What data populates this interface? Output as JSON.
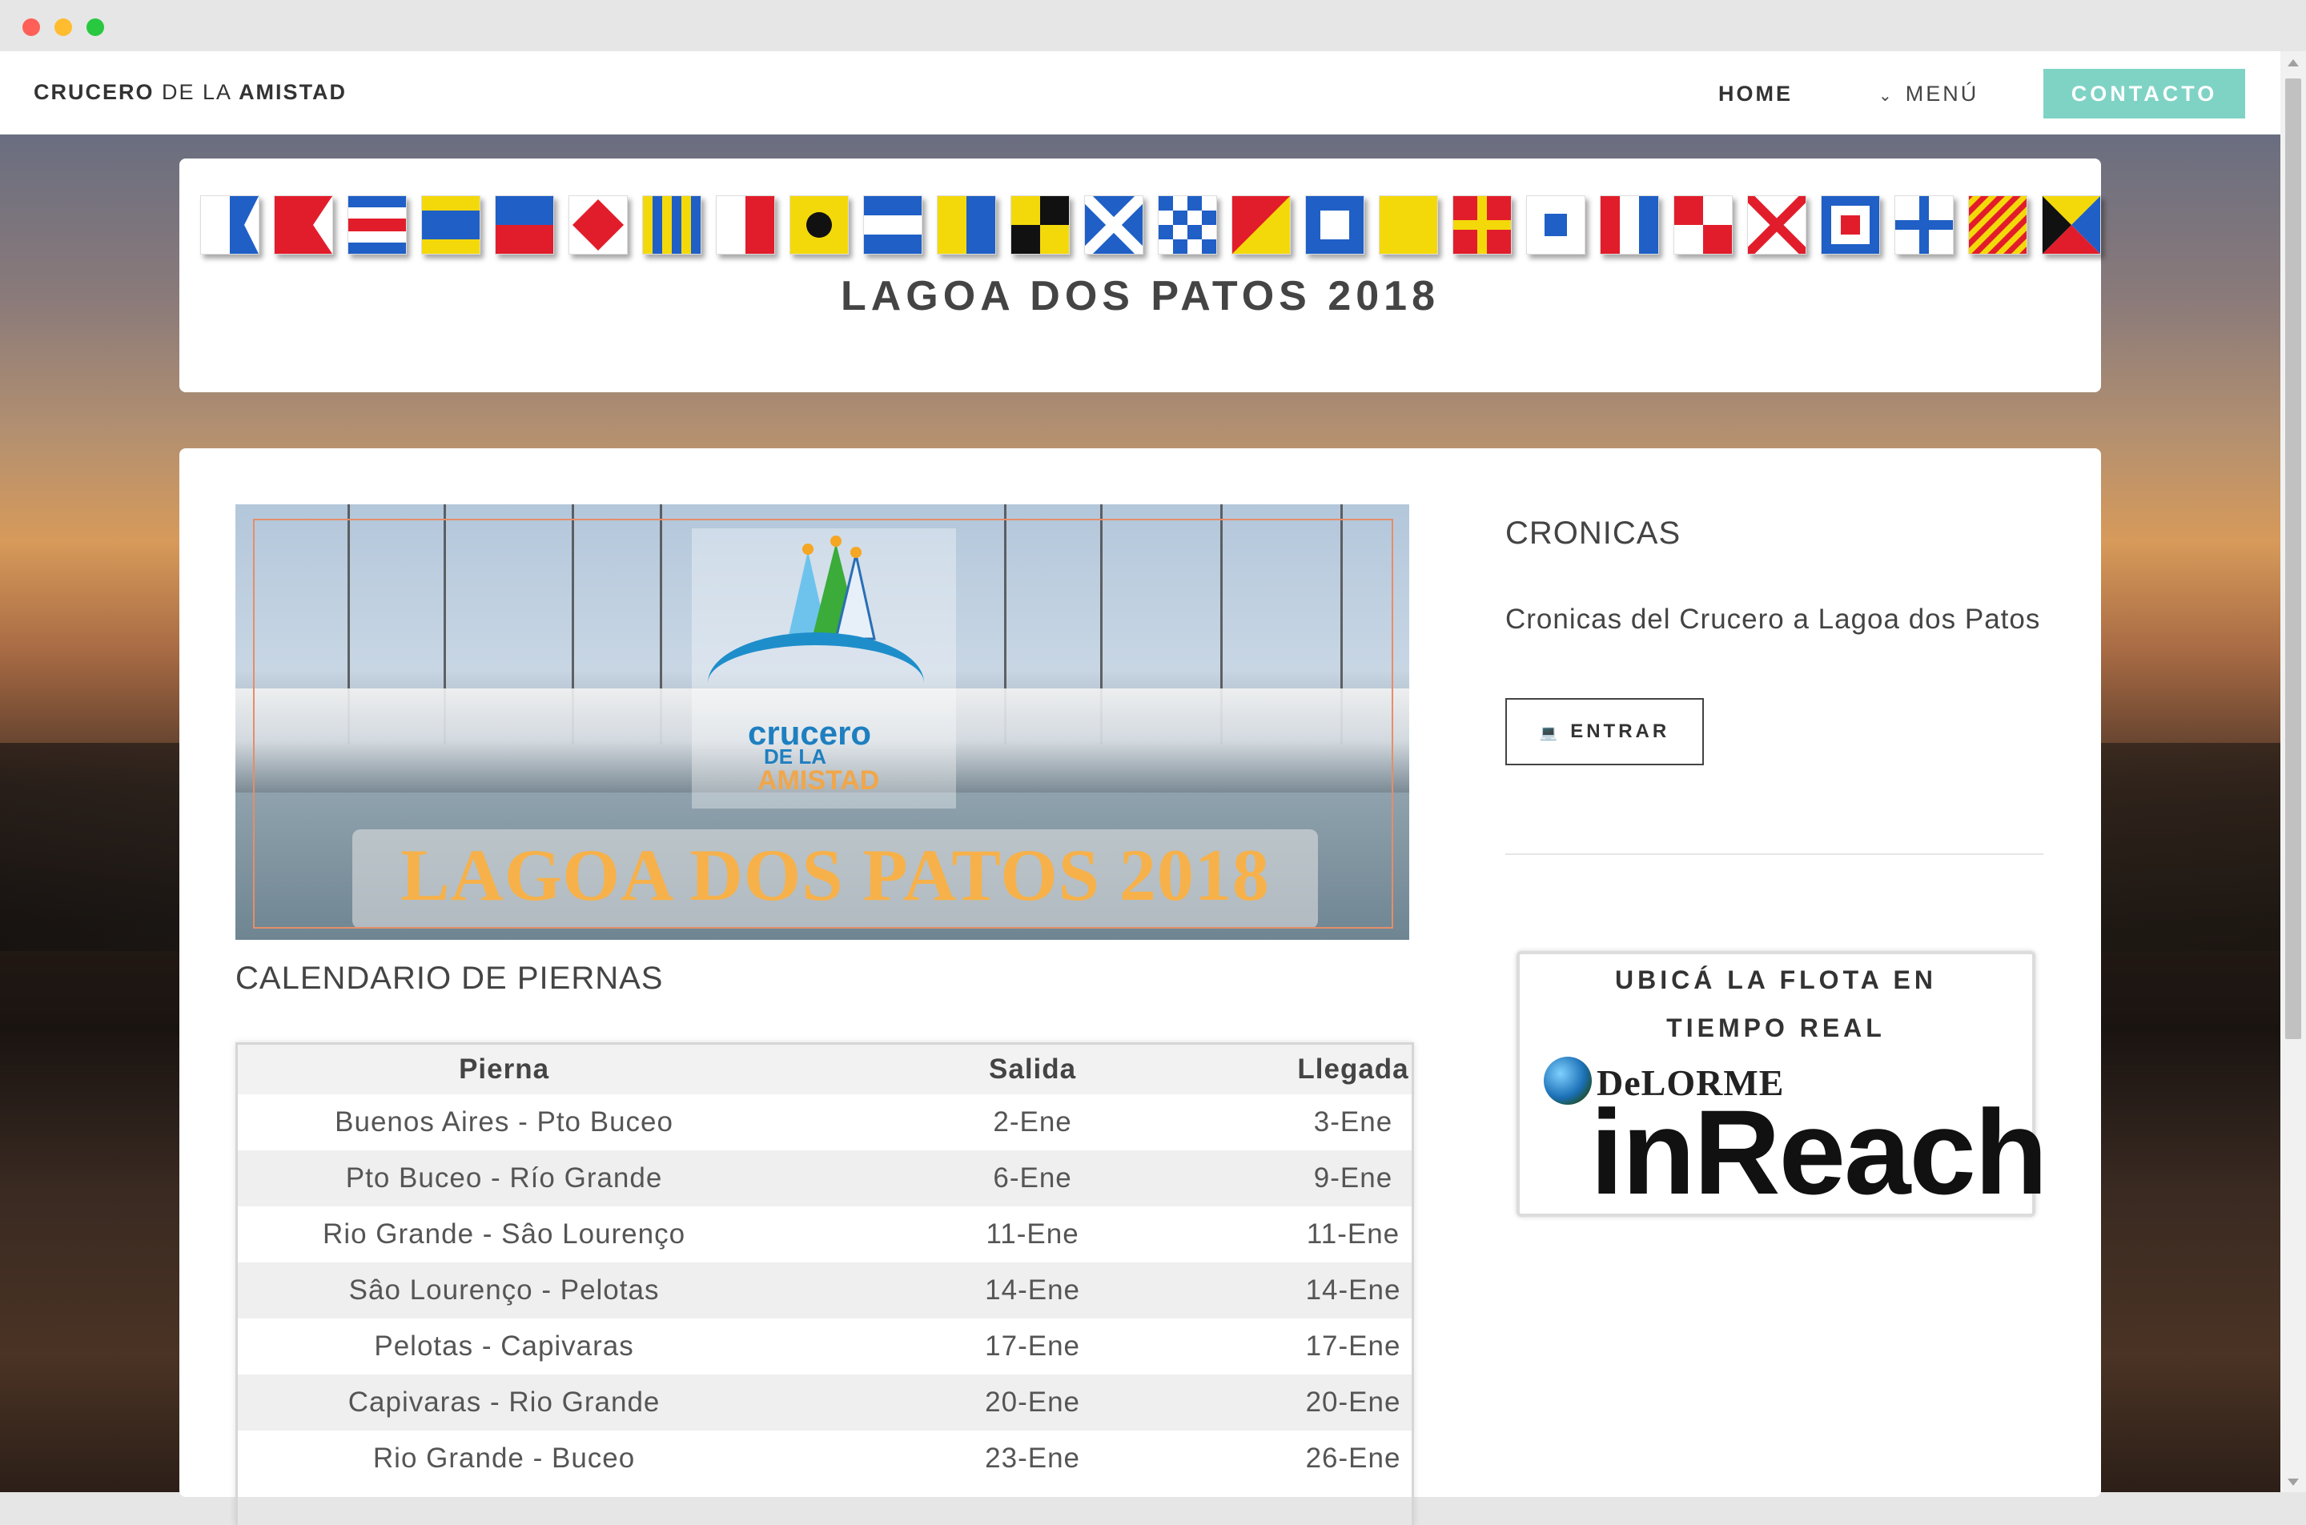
{
  "nav": {
    "brand": {
      "part1": "CRUCERO",
      "part2": " DE LA ",
      "part3": "AMISTAD"
    },
    "home": "HOME",
    "menu": "MENÚ",
    "contact": "CONTACTO"
  },
  "header": {
    "title": "LAGOA DOS PATOS 2018",
    "flags": [
      "A",
      "B",
      "C",
      "D",
      "E",
      "F",
      "G",
      "H",
      "I",
      "J",
      "K",
      "L",
      "M",
      "N",
      "O",
      "P",
      "Q",
      "R",
      "S",
      "T",
      "U",
      "V",
      "W",
      "X",
      "Y",
      "Z"
    ]
  },
  "banner": {
    "logo_line1": "crucero",
    "logo_line2": "DE LA",
    "logo_line3": "AMISTAD",
    "title": "LAGOA DOS PATOS 2018"
  },
  "calendar": {
    "heading": "CALENDARIO DE PIERNAS",
    "columns": [
      "Pierna",
      "Salida",
      "Llegada"
    ],
    "rows": [
      [
        "Buenos Aires - Pto Buceo",
        "2-Ene",
        "3-Ene"
      ],
      [
        "Pto Buceo - Río Grande",
        "6-Ene",
        "9-Ene"
      ],
      [
        "Rio Grande - Sâo Lourenço",
        "11-Ene",
        "11-Ene"
      ],
      [
        "Sâo Lourenço - Pelotas",
        "14-Ene",
        "14-Ene"
      ],
      [
        "Pelotas - Capivaras",
        "17-Ene",
        "17-Ene"
      ],
      [
        "Capivaras - Rio Grande",
        "20-Ene",
        "20-Ene"
      ],
      [
        "Rio Grande - Buceo",
        "23-Ene",
        "26-Ene"
      ]
    ]
  },
  "sidebar": {
    "title": "CRONICAS",
    "text": "Cronicas del Crucero a Lagoa dos Patos",
    "button": "ENTRAR",
    "tracker_line1": "UBICÁ LA FLOTA EN",
    "tracker_line2": "TIEMPO REAL",
    "tracker_brand": "DeLORME",
    "tracker_product": "inReach"
  }
}
